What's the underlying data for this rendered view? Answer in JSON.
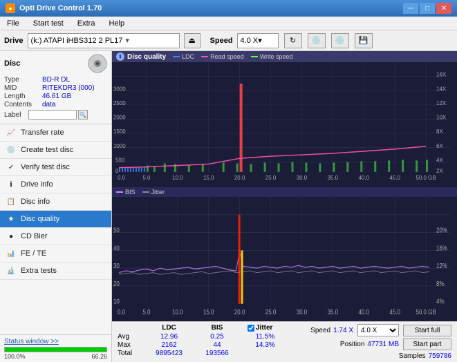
{
  "titlebar": {
    "title": "Opti Drive Control 1.70",
    "minimize": "─",
    "maximize": "□",
    "close": "✕"
  },
  "menubar": {
    "items": [
      "File",
      "Start test",
      "Extra",
      "Help"
    ]
  },
  "drivebar": {
    "label": "Drive",
    "drive_value": "(k:) ATAPI iHBS312  2 PL17",
    "speed_label": "Speed",
    "speed_value": "4.0 X"
  },
  "disc": {
    "header": "Disc",
    "type_label": "Type",
    "type_value": "BD-R DL",
    "mid_label": "MID",
    "mid_value": "RITEKDR3 (000)",
    "length_label": "Length",
    "length_value": "46.61 GB",
    "contents_label": "Contents",
    "contents_value": "data",
    "label_label": "Label"
  },
  "sidebar": {
    "items": [
      {
        "id": "transfer-rate",
        "label": "Transfer rate",
        "icon": "📈"
      },
      {
        "id": "create-test-disc",
        "label": "Create test disc",
        "icon": "💿"
      },
      {
        "id": "verify-test-disc",
        "label": "Verify test disc",
        "icon": "✓"
      },
      {
        "id": "drive-info",
        "label": "Drive info",
        "icon": "ℹ"
      },
      {
        "id": "disc-info",
        "label": "Disc info",
        "icon": "📋"
      },
      {
        "id": "disc-quality",
        "label": "Disc quality",
        "icon": "★",
        "active": true
      },
      {
        "id": "cd-bier",
        "label": "CD Bier",
        "icon": "🍺"
      },
      {
        "id": "fe-te",
        "label": "FE / TE",
        "icon": "📊"
      },
      {
        "id": "extra-tests",
        "label": "Extra tests",
        "icon": "🔬"
      }
    ]
  },
  "status": {
    "link": "Status window >>",
    "progress": 100,
    "progress_pct": "100.0%",
    "progress_val": "66.26"
  },
  "chart_top": {
    "title": "Disc quality",
    "legend": [
      {
        "label": "LDC",
        "color": "#4488ff"
      },
      {
        "label": "Read speed",
        "color": "#ff55aa"
      },
      {
        "label": "Write speed",
        "color": "#55ff55"
      }
    ]
  },
  "chart_bottom": {
    "legend": [
      {
        "label": "BIS",
        "color": "#cc88ff"
      },
      {
        "label": "Jitter",
        "color": "#888888"
      }
    ]
  },
  "stats": {
    "col_headers": [
      "LDC",
      "BIS",
      "",
      "Jitter",
      "Speed",
      ""
    ],
    "avg_label": "Avg",
    "avg_ldc": "12.96",
    "avg_bis": "0.25",
    "avg_jitter": "11.5%",
    "max_label": "Max",
    "max_ldc": "2162",
    "max_bis": "44",
    "max_jitter": "14.3%",
    "total_label": "Total",
    "total_ldc": "9895423",
    "total_bis": "193566",
    "speed_label": "Speed",
    "speed_val": "1.74 X",
    "speed_select": "4.0 X",
    "position_label": "Position",
    "position_val": "47731 MB",
    "samples_label": "Samples",
    "samples_val": "759786",
    "start_full": "Start full",
    "start_part": "Start part"
  }
}
